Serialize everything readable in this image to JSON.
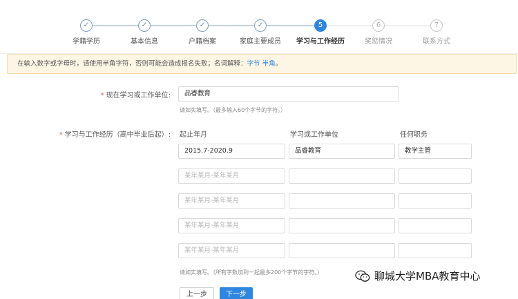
{
  "steps": [
    {
      "label": "学籍学历",
      "icon": "check-icon",
      "status": "done"
    },
    {
      "label": "基本信息",
      "icon": "check-icon",
      "status": "done"
    },
    {
      "label": "户籍档案",
      "icon": "check-icon",
      "status": "done"
    },
    {
      "label": "家庭主要成员",
      "icon": "check-icon",
      "status": "done"
    },
    {
      "label": "学习与工作经历",
      "number": "5",
      "status": "active"
    },
    {
      "label": "奖惩情况",
      "number": "6",
      "status": "todo"
    },
    {
      "label": "联系方式",
      "number": "7",
      "status": "todo"
    }
  ],
  "notice": {
    "text": "在输入数字或字母时，请使用半角字符，否则可能会造成报名失败；名词解释：",
    "links": [
      "字节",
      "半角"
    ],
    "end": "。"
  },
  "current_unit": {
    "required_mark": "*",
    "label": "现在学习或工作单位:",
    "value": "品睿教育",
    "hint": "请如实填写。（最多输入60个字节的字符。）"
  },
  "experience": {
    "required_mark": "*",
    "label": "学习与工作经历（高中毕业后起）:",
    "headers": [
      "起止年月",
      "学习或工作单位",
      "任何职务"
    ],
    "rows": [
      {
        "period": "2015.7-2020.9",
        "unit": "品睿教育",
        "role": "教学主管"
      },
      {
        "period": "",
        "unit": "",
        "role": ""
      },
      {
        "period": "",
        "unit": "",
        "role": ""
      },
      {
        "period": "",
        "unit": "",
        "role": ""
      },
      {
        "period": "",
        "unit": "",
        "role": ""
      }
    ],
    "period_placeholder": "某年某月-某年某月",
    "hint": "请如实填写。（所有字数加到一起最多200个字节的字符。）"
  },
  "buttons": {
    "prev": "上一步",
    "next": "下一步"
  },
  "watermark": {
    "text": "聊城大学MBA教育中心",
    "icon": "wechat-icon"
  },
  "colors": {
    "primary": "#2f86e0",
    "done_step": "#6f96c0",
    "notice_bg": "#fdf6e4",
    "required": "#e55555"
  }
}
